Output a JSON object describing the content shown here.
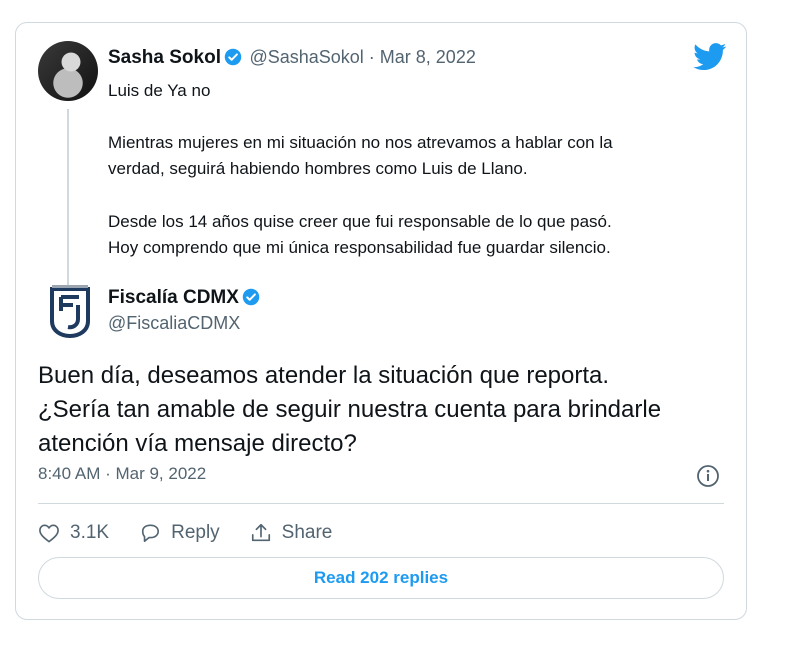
{
  "quoted": {
    "name": "Sasha Sokol",
    "handle_date": "@SashaSokol · Mar 8, 2022",
    "line1": "Luis de Ya no",
    "para1_line1": "Mientras mujeres en mi situación no nos atrevamos a hablar con la",
    "para1_line2": "verdad, seguirá habiendo hombres como Luis de Llano.",
    "para2_line1": "Desde los 14 años quise creer que fui responsable de lo que pasó.",
    "para2_line2": "Hoy comprendo que mi única responsabilidad fue guardar silencio."
  },
  "author": {
    "name": "Fiscalía CDMX",
    "handle": "@FiscaliaCDMX"
  },
  "tweet": {
    "line1": "Buen día, deseamos atender la situación que reporta.",
    "line2": "¿Sería tan amable de seguir nuestra cuenta para brindarle",
    "line3": "atención vía mensaje directo?",
    "timestamp": "8:40 AM · Mar 9, 2022"
  },
  "actions": {
    "likes": "3.1K",
    "reply": "Reply",
    "share": "Share"
  },
  "replies_button": "Read 202 replies",
  "colors": {
    "accent": "#1d9bf0",
    "border": "#cfd9de",
    "muted": "#536471"
  },
  "icons": [
    "twitter-bird-icon",
    "verified-badge-icon",
    "info-icon",
    "heart-icon",
    "reply-bubble-icon",
    "share-icon"
  ]
}
